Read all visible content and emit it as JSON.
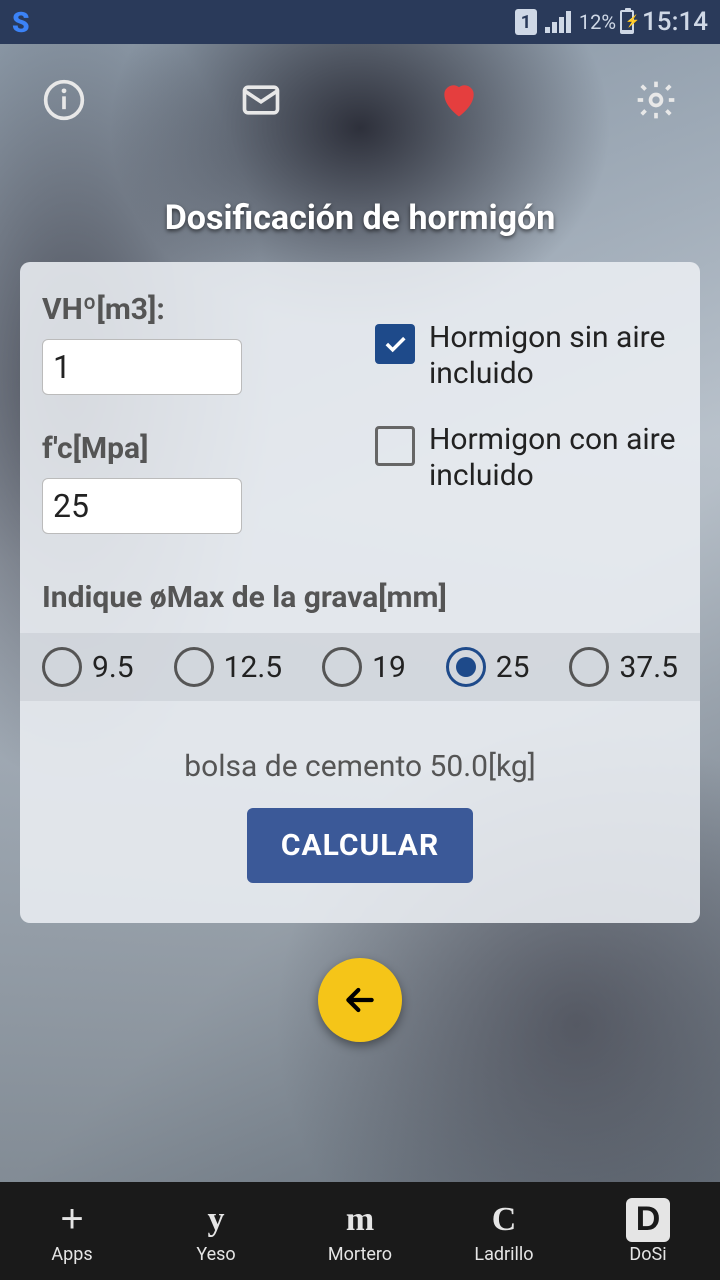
{
  "status": {
    "sim": "1",
    "battery_pct": "12%",
    "time": "15:14"
  },
  "title": "Dosificación de hormigón",
  "form": {
    "vh_label": "VHº[m3]:",
    "vh_value": "1",
    "fc_label": "f'c[Mpa]",
    "fc_value": "25",
    "cb_sin_aire": "Hormigon sin aire incluido",
    "cb_con_aire": "Hormigon con aire incluido",
    "grava_label": "Indique øMax de la grava[mm]",
    "grava_options": [
      "9.5",
      "12.5",
      "19",
      "25",
      "37.5"
    ],
    "grava_selected": "25",
    "cement_note": "bolsa de cemento 50.0[kg]",
    "calc_button": "CALCULAR"
  },
  "nav": {
    "items": [
      {
        "glyph": "+",
        "label": "Apps"
      },
      {
        "glyph": "y",
        "label": "Yeso"
      },
      {
        "glyph": "m",
        "label": "Mortero"
      },
      {
        "glyph": "C",
        "label": "Ladrillo"
      },
      {
        "glyph": "D",
        "label": "DoSi"
      }
    ]
  }
}
